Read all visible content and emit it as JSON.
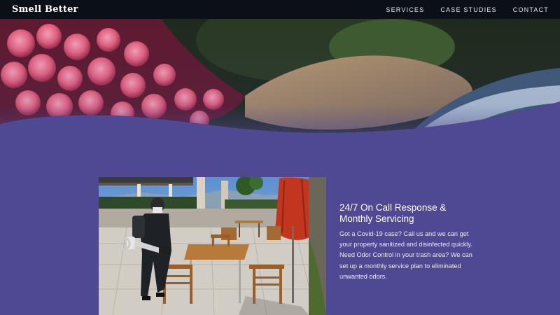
{
  "nav": {
    "logo": "Smell Better",
    "links": [
      "SERVICES",
      "CASE STUDIES",
      "CONTACT"
    ]
  },
  "service": {
    "title": "24/7 On Call Response & Monthly Servicing",
    "description": "Got a Covid-19 case? Call us and we can get your property sanitized and disinfected quickly. Need Odor Control in your trash area? We can set up a monthly service plan to eliminated unwanted odors."
  },
  "colors": {
    "background": "#4f4892",
    "nav": "#0b1018",
    "text": "#ffffff"
  }
}
